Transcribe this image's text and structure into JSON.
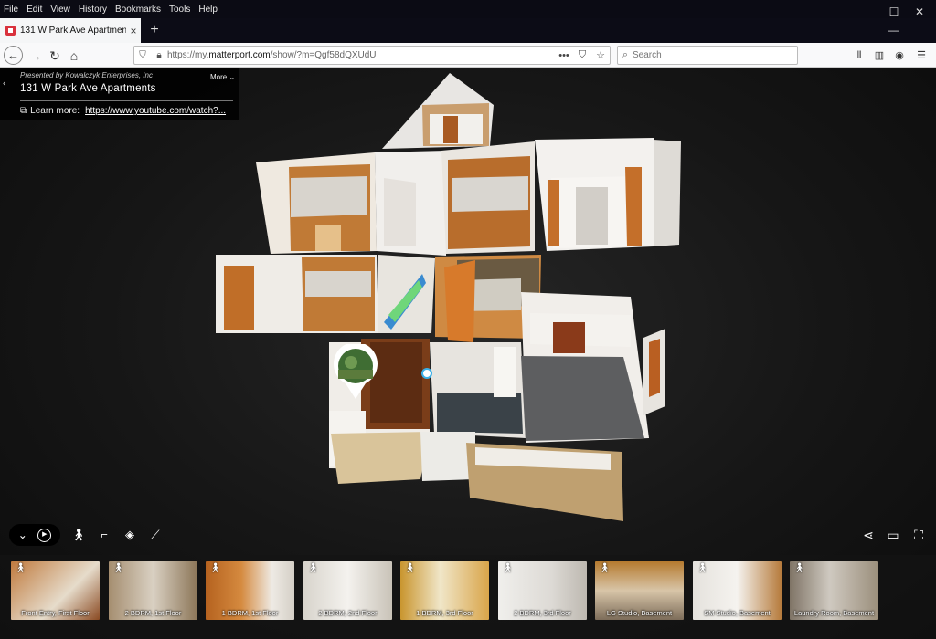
{
  "menu": [
    "File",
    "Edit",
    "View",
    "History",
    "Bookmarks",
    "Tools",
    "Help"
  ],
  "tab": {
    "title": "131 W Park Ave Apartments",
    "close": "×"
  },
  "newtab": "+",
  "window": {
    "minimize": "—",
    "maximize": "☐",
    "close": "✕"
  },
  "nav": {
    "back": "←",
    "forward": "→",
    "reload": "↻",
    "home": "⌂",
    "url_prefix": "https://my.",
    "url_domain": "matterport.com",
    "url_rest": "/show/?m=Qgf58dQXUdU",
    "page_actions": "•••",
    "search_placeholder": "Search"
  },
  "info": {
    "presented_by": "Presented by Kowalczyk Enterprises, Inc",
    "more": "More",
    "title": "131 W Park Ave Apartments",
    "learn_label": "Learn more:",
    "learn_link": "https://www.youtube.com/watch?..."
  },
  "icons": {
    "chevron-down": "chevron-down-icon",
    "play": "play-icon",
    "walk": "walk-icon",
    "floorplan": "floorplan-icon",
    "layers": "layers-icon",
    "measure": "measure-icon",
    "share": "share-icon",
    "vr": "vr-icon",
    "fullscreen": "fullscreen-icon"
  },
  "thumbnails": [
    {
      "caption": "Front Entry, First Floor",
      "color": "#b8683a"
    },
    {
      "caption": "2 BDRM, 1st Floor",
      "color": "#c9b99a"
    },
    {
      "caption": "1 BDRM, 1st Floor",
      "color": "#b5621f"
    },
    {
      "caption": "2 BDRM, 2nd Floor",
      "color": "#cfcac0"
    },
    {
      "caption": "1 BDRM, 3rd Floor",
      "color": "#c9952e"
    },
    {
      "caption": "2 BDRM, 3rd Floor",
      "color": "#e2e0dc"
    },
    {
      "caption": "LG Studio, Basement",
      "color": "#a77a3e"
    },
    {
      "caption": "SM Studio, Basement",
      "color": "#d7d2cb"
    },
    {
      "caption": "Laundry Room, Basement",
      "color": "#9b8f7c"
    }
  ]
}
